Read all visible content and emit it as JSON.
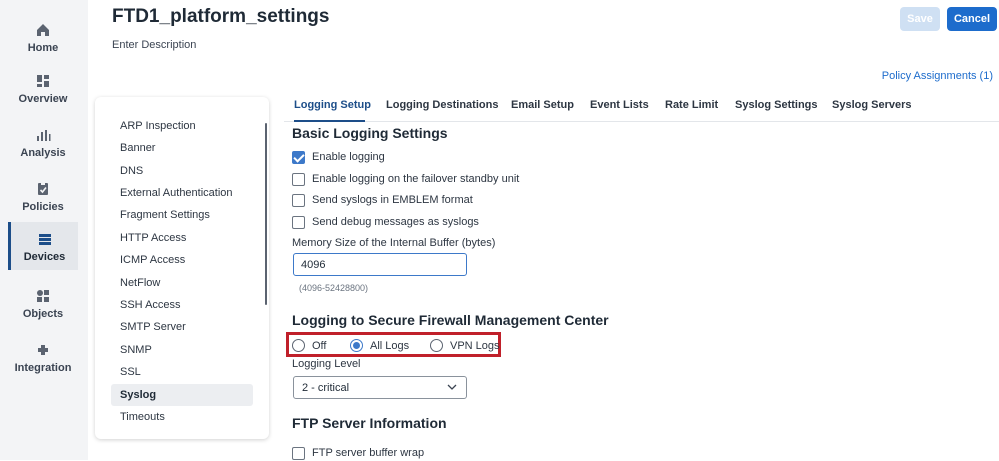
{
  "nav": {
    "items": [
      {
        "label": "Home",
        "icon": "home-icon"
      },
      {
        "label": "Overview",
        "icon": "overview-icon"
      },
      {
        "label": "Analysis",
        "icon": "analysis-icon"
      },
      {
        "label": "Policies",
        "icon": "policies-icon"
      },
      {
        "label": "Devices",
        "icon": "devices-icon",
        "active": true
      },
      {
        "label": "Objects",
        "icon": "objects-icon"
      },
      {
        "label": "Integration",
        "icon": "integration-icon"
      }
    ]
  },
  "header": {
    "title": "FTD1_platform_settings",
    "description": "Enter Description",
    "save_label": "Save",
    "cancel_label": "Cancel",
    "policy_assignments": "Policy Assignments (1)"
  },
  "sidebar": {
    "items": [
      "ARP Inspection",
      "Banner",
      "DNS",
      "External Authentication",
      "Fragment Settings",
      "HTTP Access",
      "ICMP Access",
      "NetFlow",
      "SSH Access",
      "SMTP Server",
      "SNMP",
      "SSL",
      "Syslog",
      "Timeouts"
    ],
    "selected": "Syslog"
  },
  "tabs": [
    {
      "label": "Logging Setup",
      "active": true
    },
    {
      "label": "Logging Destinations"
    },
    {
      "label": "Email Setup"
    },
    {
      "label": "Event Lists"
    },
    {
      "label": "Rate Limit"
    },
    {
      "label": "Syslog Settings"
    },
    {
      "label": "Syslog Servers"
    }
  ],
  "basic": {
    "title": "Basic Logging Settings",
    "enable_logging": {
      "label": "Enable logging",
      "checked": true
    },
    "enable_failover": {
      "label": "Enable logging on the failover standby unit",
      "checked": false
    },
    "emblem": {
      "label": "Send syslogs in EMBLEM format",
      "checked": false
    },
    "debug": {
      "label": "Send debug messages as syslogs",
      "checked": false
    },
    "buffer_label": "Memory Size of the Internal Buffer (bytes)",
    "buffer_value": "4096",
    "buffer_hint": "(4096-52428800)"
  },
  "fmc": {
    "title": "Logging to Secure Firewall Management Center",
    "options": [
      "Off",
      "All Logs",
      "VPN Logs"
    ],
    "selected": "All Logs",
    "level_label": "Logging Level",
    "level_value": "2 - critical"
  },
  "ftp": {
    "title": "FTP Server Information",
    "buffer_wrap": {
      "label": "FTP server buffer wrap",
      "checked": false
    }
  },
  "colors": {
    "accent": "#1d6ccc",
    "active_tab": "#1d4e89",
    "highlight_box": "#c0202a",
    "checkbox_checked": "#3d79c9"
  }
}
